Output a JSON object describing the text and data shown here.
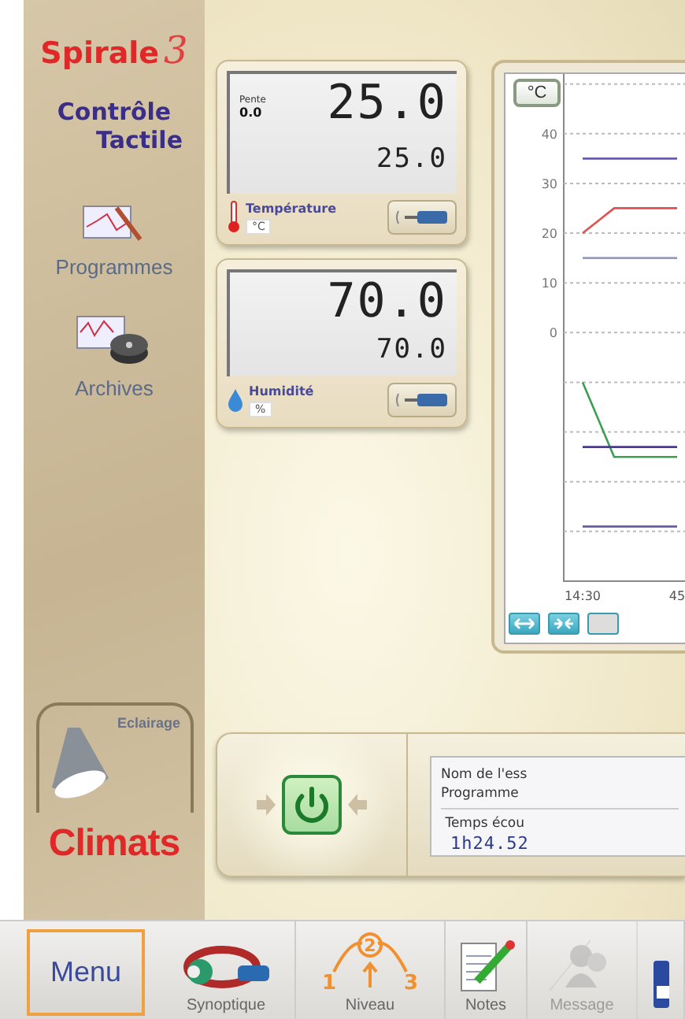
{
  "sidebar": {
    "brand": "Spirale",
    "brand_version": "3",
    "title_lines": [
      "Contrôle",
      "Tactile"
    ],
    "items": [
      {
        "kind": "programs",
        "label": "Programmes"
      },
      {
        "kind": "archives",
        "label": "Archives"
      }
    ],
    "lighting_tab": {
      "label": "Eclairage"
    },
    "logo": "Climats"
  },
  "measurements": [
    {
      "kind": "temperature",
      "slope_label": "Pente",
      "slope_value": "0.0",
      "value": "25.0",
      "setpoint": "25.0",
      "label": "Température",
      "unit": "°C"
    },
    {
      "kind": "humidity",
      "value": "70.0",
      "setpoint": "70.0",
      "label": "Humidité",
      "unit": "%"
    }
  ],
  "chart": {
    "unit_button": "°C",
    "chart_data": {
      "type": "line",
      "categories": [
        "14:30",
        null,
        null,
        "45"
      ],
      "ylim": [
        -50,
        52
      ],
      "grid": true,
      "yticks": [
        0,
        10,
        20,
        30,
        40
      ],
      "series": [
        {
          "color": "#e05050",
          "values": [
            20,
            25,
            25,
            25
          ]
        },
        {
          "color": "#6a5aa8",
          "values": [
            35,
            35,
            35,
            35
          ]
        },
        {
          "color": "#9a9ab8",
          "values": [
            15,
            15,
            15,
            15
          ]
        },
        {
          "color": "#3aa050",
          "values": [
            -10,
            -25,
            -25,
            -25
          ]
        },
        {
          "color": "#4a3a88",
          "values": [
            -23,
            -23,
            -23,
            -23
          ]
        },
        {
          "color": "#6a5aa8",
          "values": [
            -39,
            -39,
            -39,
            -39
          ]
        }
      ]
    }
  },
  "run_panel": {
    "test_name_label": "Nom de l'ess",
    "program_label": "Programme",
    "elapsed_label": "Temps écou",
    "elapsed_value": "1h24.52"
  },
  "toolbar": {
    "menu": "Menu",
    "items": [
      {
        "kind": "synoptic",
        "label": "Synoptique",
        "disabled": false
      },
      {
        "kind": "level",
        "label": "Niveau",
        "digits": [
          "1",
          "2",
          "3"
        ],
        "disabled": false
      },
      {
        "kind": "notes",
        "label": "Notes",
        "disabled": false
      },
      {
        "kind": "message",
        "label": "Message",
        "disabled": true
      },
      {
        "kind": "device",
        "disabled": false
      }
    ]
  }
}
